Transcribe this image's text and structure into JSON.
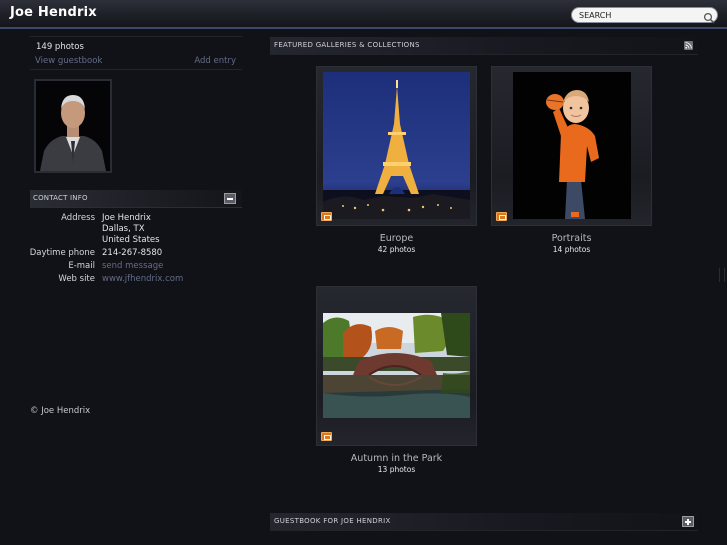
{
  "header": {
    "site_title": "Joe Hendrix",
    "search_placeholder": "SEARCH"
  },
  "profile": {
    "photo_count": "149 photos",
    "view_guestbook": "View guestbook",
    "add_entry": "Add entry"
  },
  "contact": {
    "section_title": "CONTACT INFO",
    "address_label": "Address",
    "address_line1": "Joe Hendrix",
    "address_line2": "Dallas, TX",
    "address_line3": "United States",
    "phone_label": "Daytime phone",
    "phone_value": "214-267-8580",
    "email_label": "E-mail",
    "email_value": "send message",
    "website_label": "Web site",
    "website_value": "www.jfhendrix.com"
  },
  "footer": {
    "copyright": "© Joe Hendrix"
  },
  "featured": {
    "section_title": "FEATURED GALLERIES & COLLECTIONS",
    "galleries": [
      {
        "name": "Europe",
        "count": "42 photos"
      },
      {
        "name": "Portraits",
        "count": "14 photos"
      },
      {
        "name": "Autumn in the Park",
        "count": "13 photos"
      }
    ]
  },
  "guestbook": {
    "section_title": "GUESTBOOK FOR JOE HENDRIX"
  },
  "icons": {
    "search": "search-icon",
    "collapse": "minus-icon",
    "expand": "plus-icon",
    "rss": "rss-icon",
    "gallery_badge": "gallery-icon"
  }
}
